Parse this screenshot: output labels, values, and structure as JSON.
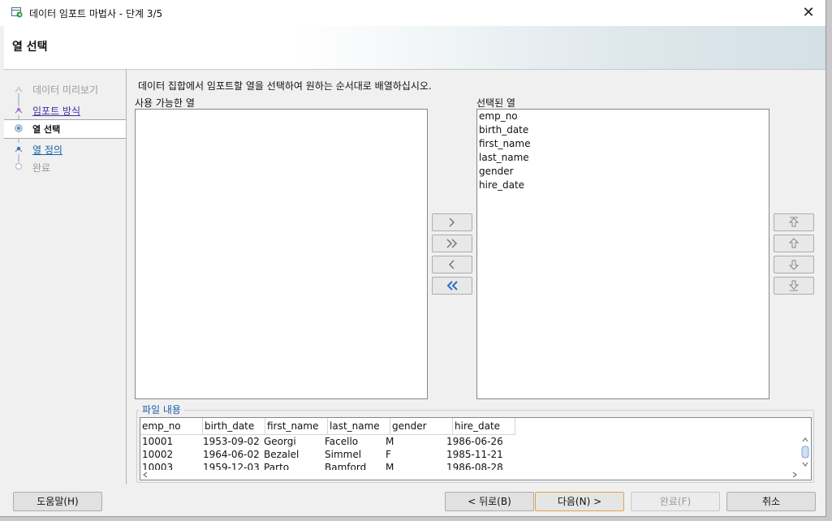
{
  "window": {
    "title": "데이터 임포트 마법사 - 단계 3/5"
  },
  "header": {
    "title": "열 선택"
  },
  "steps": [
    {
      "label": "데이터 미리보기",
      "state": "disabled"
    },
    {
      "label": "임포트 방식",
      "state": "link"
    },
    {
      "label": "열 선택",
      "state": "active"
    },
    {
      "label": "열 정의",
      "state": "link"
    },
    {
      "label": "완료",
      "state": "pending"
    }
  ],
  "instruction": "데이터 집합에서 임포트할 열을 선택하여 원하는 순서대로 배열하십시오.",
  "available": {
    "label": "사용 가능한 열",
    "items": []
  },
  "selected": {
    "label": "선택된 열",
    "items": [
      "emp_no",
      "birth_date",
      "first_name",
      "last_name",
      "gender",
      "hire_date"
    ]
  },
  "file_content": {
    "legend": "파일 내용",
    "columns": [
      "emp_no",
      "birth_date",
      "first_name",
      "last_name",
      "gender",
      "hire_date"
    ],
    "rows": [
      [
        "10001",
        "1953-09-02",
        "Georgi",
        "Facello",
        "M",
        "1986-06-26"
      ],
      [
        "10002",
        "1964-06-02",
        "Bezalel",
        "Simmel",
        "F",
        "1985-11-21"
      ],
      [
        "10003",
        "1959-12-03",
        "Parto",
        "Bamford",
        "M",
        "1986-08-28"
      ]
    ]
  },
  "buttons": {
    "help": "도움말(H)",
    "back": "< 뒤로(B)",
    "next": "다음(N) >",
    "finish": "완료(F)",
    "cancel": "취소"
  },
  "icons": {
    "move_right": "chevron-right-icon",
    "move_all_right": "double-chevron-right-icon",
    "move_left": "chevron-left-icon",
    "move_all_left": "double-chevron-left-icon",
    "move_top": "arrow-top-icon",
    "move_up": "arrow-up-icon",
    "move_down": "arrow-down-icon",
    "move_bottom": "arrow-bottom-icon"
  },
  "colors": {
    "link": "#4b2ca0",
    "accent": "#1a5ea8",
    "focus_border": "#e3a24a"
  }
}
